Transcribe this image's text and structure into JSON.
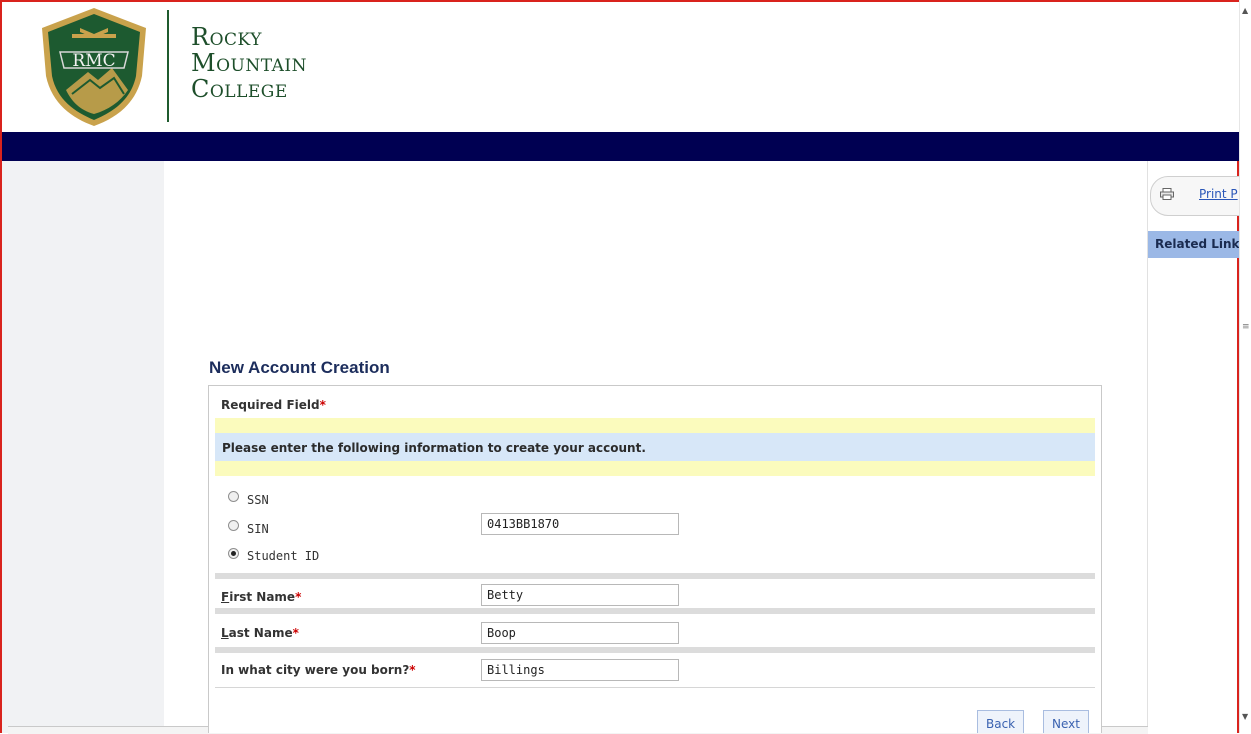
{
  "header": {
    "logo_text": "RMC",
    "college_name_lines": [
      "Rocky",
      "Mountain",
      "College"
    ]
  },
  "sidebar": {
    "print_link": "Print P",
    "related_links_label": "Related Link"
  },
  "form": {
    "title": "New Account Creation",
    "required_label": "Required Field",
    "required_star": "*",
    "instructions": "Please enter the following information to create your account.",
    "id_options": [
      {
        "label": "SSN",
        "selected": false
      },
      {
        "label": "SIN",
        "selected": false
      },
      {
        "label": "Student ID",
        "selected": true
      }
    ],
    "id_value": "0413BB1870",
    "fields": {
      "first_name": {
        "access_key": "F",
        "label_rest": "irst Name",
        "value": "Betty"
      },
      "last_name": {
        "access_key": "L",
        "label_rest": "ast Name",
        "value": "Boop"
      },
      "birth_city": {
        "label": "In what city were you born?",
        "value": "Billings"
      }
    },
    "buttons": {
      "back": "Back",
      "next": "Next"
    }
  },
  "colors": {
    "navbar": "#000052",
    "brand_green": "#1e4f2b",
    "frame_border": "#d9231d",
    "info_bar": "#d7e7f8",
    "highlight_yellow": "#fbfbbd",
    "required_star": "#cc0000",
    "related_links_bg": "#9bb8e6"
  },
  "icons": {
    "print": "printer-icon",
    "logo": "rmc-shield-logo"
  }
}
